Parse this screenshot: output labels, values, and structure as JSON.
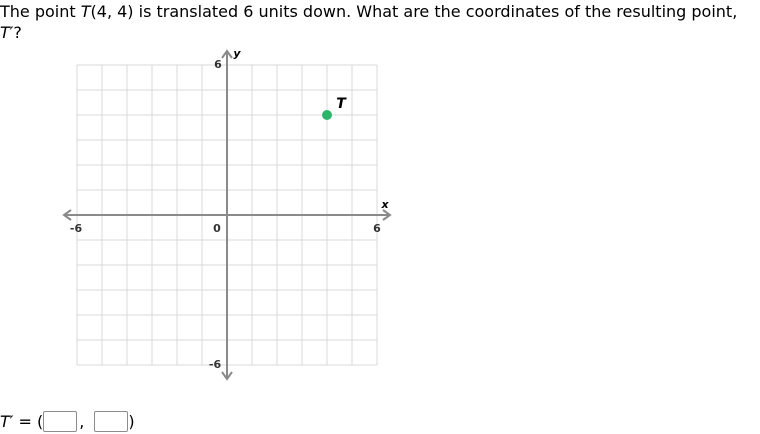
{
  "question": {
    "part1": "The point ",
    "point_name": "T",
    "part2": "(4, 4) is translated 6 units down. What are the coordinates of the resulting point, ",
    "image_name": "T′",
    "part3": "?"
  },
  "graph": {
    "x_axis_label": "x",
    "y_axis_label": "y",
    "origin_label": "0",
    "x_min_label": "-6",
    "x_max_label": "6",
    "y_max_label": "6",
    "y_min_label": "-6",
    "point": {
      "label": "T",
      "x": 4,
      "y": 4,
      "color": "#2ab56b"
    },
    "grid_color": "#d9d9d9",
    "axis_color": "#8a8a8a"
  },
  "answer": {
    "label": "T′",
    "equals": " = (",
    "comma": ",",
    "close": ")",
    "x_value": "",
    "y_value": ""
  }
}
